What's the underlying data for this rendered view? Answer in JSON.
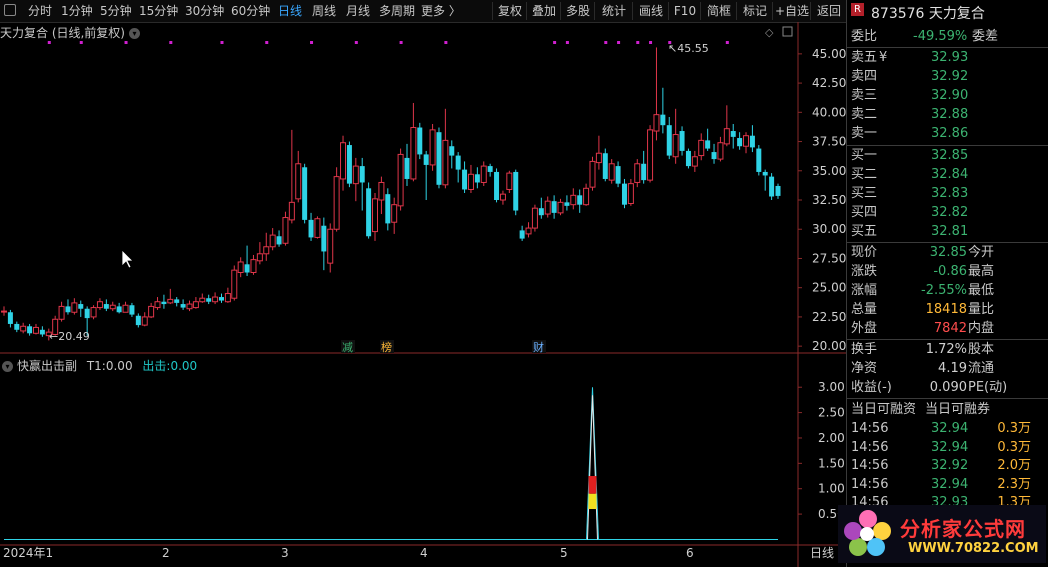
{
  "toolbar": {
    "periods": [
      "分时",
      "1分钟",
      "5分钟",
      "15分钟",
      "30分钟",
      "60分钟",
      "日线",
      "周线",
      "月线",
      "多周期",
      "更多 〉"
    ],
    "active_period": "日线",
    "right_buttons": [
      "复权",
      "叠加",
      "多股",
      "统计",
      "画线",
      "F10",
      "简框",
      "标记",
      "+自选",
      "返回"
    ]
  },
  "main_chart_title": "天力复合 (日线,前复权)",
  "sub_indicator": {
    "name": "快赢出击副",
    "t1_label": "T1:",
    "t1_value": "0.00",
    "chuji_label": "出击:",
    "chuji_value": "0.00"
  },
  "markers": [
    "减",
    "榜",
    "财"
  ],
  "date_axis": [
    "2024年1",
    "2",
    "3",
    "4",
    "5",
    "6"
  ],
  "period_label": "日线",
  "annotations": {
    "high": "45.55",
    "low": "20.49"
  },
  "quote": {
    "badge": "R",
    "code_name": "873576 天力复合",
    "weibi_label": "委比",
    "weibi_value": "-49.59%",
    "weicha_label": "委差",
    "sell": [
      {
        "label": "卖五",
        "value": "32.93"
      },
      {
        "label": "卖四",
        "value": "32.92"
      },
      {
        "label": "卖三",
        "value": "32.90"
      },
      {
        "label": "卖二",
        "value": "32.88"
      },
      {
        "label": "卖一",
        "value": "32.86"
      }
    ],
    "buy": [
      {
        "label": "买一",
        "value": "32.85"
      },
      {
        "label": "买二",
        "value": "32.84"
      },
      {
        "label": "买三",
        "value": "32.83"
      },
      {
        "label": "买四",
        "value": "32.82"
      },
      {
        "label": "买五",
        "value": "32.81"
      }
    ],
    "yen": "¥",
    "stats": [
      {
        "l": "现价",
        "v": "32.85",
        "c": "#3cb371",
        "r": "今开"
      },
      {
        "l": "涨跌",
        "v": "-0.86",
        "c": "#3cb371",
        "r": "最高"
      },
      {
        "l": "涨幅",
        "v": "-2.55%",
        "c": "#3cb371",
        "r": "最低"
      },
      {
        "l": "总量",
        "v": "18418",
        "c": "#ffb938",
        "r": "量比"
      },
      {
        "l": "外盘",
        "v": "7842",
        "c": "#ff4d4d",
        "r": "内盘"
      }
    ],
    "stats2": [
      {
        "l": "换手",
        "v": "1.72%",
        "r": "股本"
      },
      {
        "l": "净资",
        "v": "4.19",
        "r": "流通"
      },
      {
        "l": "收益(-)",
        "v": "0.090",
        "r": "PE(动)"
      }
    ],
    "margin_left": "当日可融资",
    "margin_right": "当日可融券",
    "ticks": [
      {
        "t": "14:56",
        "p": "32.94",
        "v": "0.3万"
      },
      {
        "t": "14:56",
        "p": "32.94",
        "v": "0.3万"
      },
      {
        "t": "14:56",
        "p": "32.92",
        "v": "2.0万"
      },
      {
        "t": "14:56",
        "p": "32.94",
        "v": "2.3万"
      },
      {
        "t": "14:56",
        "p": "32.93",
        "v": "1.3万"
      }
    ]
  },
  "logo": {
    "text": "分析家公式网",
    "url": "WWW.70822.COM"
  },
  "colors": {
    "up": "#e0364a",
    "down": "#2fd3e6",
    "accent": "#39a7ff",
    "magenta": "#d020d0"
  },
  "chart_data": [
    {
      "type": "candlestick",
      "title": "天力复合 (日线,前复权)",
      "yticks": [
        20.0,
        22.5,
        25.0,
        27.5,
        30.0,
        32.5,
        35.0,
        37.5,
        40.0,
        42.5,
        45.0
      ],
      "ylim": [
        19.5,
        46.1
      ],
      "annotations": [
        {
          "text": "45.55",
          "value": 45.55
        },
        {
          "text": "20.49",
          "value": 20.49
        }
      ],
      "candles": [
        {
          "o": 23.0,
          "c": 23.0,
          "h": 23.4,
          "l": 22.6
        },
        {
          "o": 22.9,
          "c": 21.9,
          "h": 23.1,
          "l": 21.6
        },
        {
          "o": 21.9,
          "c": 21.4,
          "h": 22.1,
          "l": 21.2
        },
        {
          "o": 21.3,
          "c": 21.7,
          "h": 22.0,
          "l": 21.1
        },
        {
          "o": 21.7,
          "c": 21.1,
          "h": 21.9,
          "l": 20.9
        },
        {
          "o": 21.1,
          "c": 21.6,
          "h": 21.9,
          "l": 21.0
        },
        {
          "o": 21.4,
          "c": 21.0,
          "h": 21.7,
          "l": 20.8
        },
        {
          "o": 20.9,
          "c": 21.2,
          "h": 21.5,
          "l": 20.49
        },
        {
          "o": 21.0,
          "c": 22.3,
          "h": 22.6,
          "l": 20.9
        },
        {
          "o": 22.3,
          "c": 23.4,
          "h": 23.8,
          "l": 22.1
        },
        {
          "o": 23.4,
          "c": 22.9,
          "h": 24.0,
          "l": 22.7
        },
        {
          "o": 22.9,
          "c": 23.7,
          "h": 24.1,
          "l": 22.7
        },
        {
          "o": 23.6,
          "c": 23.2,
          "h": 23.9,
          "l": 22.5
        },
        {
          "o": 23.2,
          "c": 22.4,
          "h": 23.4,
          "l": 20.9
        },
        {
          "o": 22.5,
          "c": 23.3,
          "h": 23.5,
          "l": 22.3
        },
        {
          "o": 23.3,
          "c": 23.8,
          "h": 24.1,
          "l": 23.1
        },
        {
          "o": 23.6,
          "c": 23.2,
          "h": 24.0,
          "l": 23.0
        },
        {
          "o": 23.2,
          "c": 23.5,
          "h": 23.8,
          "l": 23.0
        },
        {
          "o": 23.4,
          "c": 22.9,
          "h": 23.7,
          "l": 22.8
        },
        {
          "o": 22.9,
          "c": 23.5,
          "h": 23.8,
          "l": 22.9
        },
        {
          "o": 23.5,
          "c": 22.7,
          "h": 23.7,
          "l": 22.5
        },
        {
          "o": 22.6,
          "c": 21.8,
          "h": 22.8,
          "l": 21.6
        },
        {
          "o": 21.8,
          "c": 22.5,
          "h": 22.9,
          "l": 21.7
        },
        {
          "o": 22.5,
          "c": 23.4,
          "h": 23.7,
          "l": 22.4
        },
        {
          "o": 23.3,
          "c": 23.8,
          "h": 24.2,
          "l": 23.1
        },
        {
          "o": 23.8,
          "c": 23.6,
          "h": 24.4,
          "l": 23.2
        },
        {
          "o": 23.7,
          "c": 24.0,
          "h": 24.9,
          "l": 23.6
        },
        {
          "o": 24.0,
          "c": 23.7,
          "h": 24.2,
          "l": 23.4
        },
        {
          "o": 23.6,
          "c": 23.3,
          "h": 24.0,
          "l": 23.1
        },
        {
          "o": 23.2,
          "c": 23.6,
          "h": 23.9,
          "l": 23.0
        },
        {
          "o": 23.3,
          "c": 23.8,
          "h": 24.2,
          "l": 23.2
        },
        {
          "o": 23.8,
          "c": 24.1,
          "h": 24.5,
          "l": 23.7
        },
        {
          "o": 24.1,
          "c": 23.8,
          "h": 24.4,
          "l": 23.6
        },
        {
          "o": 23.8,
          "c": 24.2,
          "h": 24.6,
          "l": 23.6
        },
        {
          "o": 24.2,
          "c": 23.9,
          "h": 24.5,
          "l": 23.7
        },
        {
          "o": 23.8,
          "c": 24.5,
          "h": 25.0,
          "l": 23.7
        },
        {
          "o": 24.1,
          "c": 26.5,
          "h": 26.9,
          "l": 23.9
        },
        {
          "o": 26.3,
          "c": 27.2,
          "h": 27.6,
          "l": 25.9
        },
        {
          "o": 27.0,
          "c": 26.3,
          "h": 28.6,
          "l": 26.0
        },
        {
          "o": 26.3,
          "c": 27.4,
          "h": 27.8,
          "l": 26.1
        },
        {
          "o": 27.3,
          "c": 27.9,
          "h": 28.9,
          "l": 27.0
        },
        {
          "o": 27.9,
          "c": 28.5,
          "h": 29.7,
          "l": 27.3
        },
        {
          "o": 28.5,
          "c": 29.5,
          "h": 30.1,
          "l": 28.2
        },
        {
          "o": 29.4,
          "c": 28.7,
          "h": 29.9,
          "l": 28.5
        },
        {
          "o": 28.8,
          "c": 31.0,
          "h": 31.5,
          "l": 28.6
        },
        {
          "o": 30.8,
          "c": 32.3,
          "h": 38.5,
          "l": 30.5
        },
        {
          "o": 32.6,
          "c": 35.6,
          "h": 36.7,
          "l": 32.3
        },
        {
          "o": 35.3,
          "c": 30.8,
          "h": 35.6,
          "l": 30.5
        },
        {
          "o": 30.8,
          "c": 29.3,
          "h": 31.4,
          "l": 29.0
        },
        {
          "o": 29.3,
          "c": 30.9,
          "h": 31.1,
          "l": 29.2
        },
        {
          "o": 30.3,
          "c": 28.1,
          "h": 31.0,
          "l": 26.5
        },
        {
          "o": 27.1,
          "c": 30.0,
          "h": 30.5,
          "l": 26.3
        },
        {
          "o": 30.0,
          "c": 34.5,
          "h": 35.3,
          "l": 29.8
        },
        {
          "o": 34.3,
          "c": 37.4,
          "h": 38.0,
          "l": 33.3
        },
        {
          "o": 37.2,
          "c": 33.9,
          "h": 37.5,
          "l": 33.6
        },
        {
          "o": 33.9,
          "c": 35.4,
          "h": 36.1,
          "l": 32.4
        },
        {
          "o": 35.4,
          "c": 34.0,
          "h": 36.1,
          "l": 31.6
        },
        {
          "o": 33.5,
          "c": 29.4,
          "h": 34.0,
          "l": 29.2
        },
        {
          "o": 29.8,
          "c": 32.6,
          "h": 33.1,
          "l": 29.0
        },
        {
          "o": 32.5,
          "c": 34.0,
          "h": 34.5,
          "l": 31.3
        },
        {
          "o": 33.0,
          "c": 30.5,
          "h": 33.5,
          "l": 29.9
        },
        {
          "o": 30.6,
          "c": 32.1,
          "h": 32.7,
          "l": 29.6
        },
        {
          "o": 32.0,
          "c": 36.4,
          "h": 36.9,
          "l": 31.6
        },
        {
          "o": 36.1,
          "c": 34.3,
          "h": 37.3,
          "l": 33.7
        },
        {
          "o": 34.3,
          "c": 38.7,
          "h": 40.8,
          "l": 34.1
        },
        {
          "o": 38.7,
          "c": 36.4,
          "h": 39.1,
          "l": 36.0
        },
        {
          "o": 36.4,
          "c": 35.5,
          "h": 36.7,
          "l": 32.5
        },
        {
          "o": 35.5,
          "c": 38.5,
          "h": 39.0,
          "l": 35.0
        },
        {
          "o": 38.3,
          "c": 33.8,
          "h": 38.7,
          "l": 33.5
        },
        {
          "o": 33.8,
          "c": 37.6,
          "h": 40.3,
          "l": 33.5
        },
        {
          "o": 37.1,
          "c": 36.3,
          "h": 37.6,
          "l": 35.2
        },
        {
          "o": 36.3,
          "c": 35.1,
          "h": 36.6,
          "l": 34.0
        },
        {
          "o": 35.1,
          "c": 33.4,
          "h": 35.8,
          "l": 33.1
        },
        {
          "o": 33.4,
          "c": 34.7,
          "h": 35.5,
          "l": 33.1
        },
        {
          "o": 34.7,
          "c": 34.0,
          "h": 35.3,
          "l": 33.5
        },
        {
          "o": 34.0,
          "c": 35.4,
          "h": 35.8,
          "l": 33.7
        },
        {
          "o": 35.4,
          "c": 34.9,
          "h": 35.6,
          "l": 34.5
        },
        {
          "o": 34.9,
          "c": 32.5,
          "h": 35.2,
          "l": 32.3
        },
        {
          "o": 32.5,
          "c": 33.0,
          "h": 33.3,
          "l": 32.1
        },
        {
          "o": 33.4,
          "c": 34.8,
          "h": 35.0,
          "l": 33.1
        },
        {
          "o": 34.9,
          "c": 31.6,
          "h": 35.1,
          "l": 31.2
        },
        {
          "o": 29.9,
          "c": 29.2,
          "h": 30.3,
          "l": 29.0
        },
        {
          "o": 29.6,
          "c": 30.1,
          "h": 30.6,
          "l": 29.3
        },
        {
          "o": 30.1,
          "c": 31.8,
          "h": 32.1,
          "l": 29.8
        },
        {
          "o": 31.8,
          "c": 31.2,
          "h": 32.7,
          "l": 30.9
        },
        {
          "o": 31.3,
          "c": 32.4,
          "h": 32.8,
          "l": 31.0
        },
        {
          "o": 32.4,
          "c": 31.4,
          "h": 32.9,
          "l": 30.9
        },
        {
          "o": 31.4,
          "c": 32.3,
          "h": 32.6,
          "l": 31.2
        },
        {
          "o": 32.3,
          "c": 32.0,
          "h": 32.9,
          "l": 31.6
        },
        {
          "o": 32.1,
          "c": 32.9,
          "h": 33.5,
          "l": 31.7
        },
        {
          "o": 32.9,
          "c": 32.1,
          "h": 33.4,
          "l": 31.4
        },
        {
          "o": 32.1,
          "c": 33.5,
          "h": 33.9,
          "l": 32.0
        },
        {
          "o": 33.6,
          "c": 35.8,
          "h": 36.2,
          "l": 33.3
        },
        {
          "o": 35.7,
          "c": 36.5,
          "h": 38.0,
          "l": 35.1
        },
        {
          "o": 36.5,
          "c": 34.3,
          "h": 36.9,
          "l": 34.1
        },
        {
          "o": 34.2,
          "c": 35.6,
          "h": 36.0,
          "l": 33.9
        },
        {
          "o": 35.4,
          "c": 33.9,
          "h": 35.8,
          "l": 33.6
        },
        {
          "o": 33.9,
          "c": 32.1,
          "h": 34.3,
          "l": 31.8
        },
        {
          "o": 32.2,
          "c": 33.9,
          "h": 34.3,
          "l": 32.0
        },
        {
          "o": 34.0,
          "c": 35.6,
          "h": 36.0,
          "l": 33.6
        },
        {
          "o": 35.6,
          "c": 34.2,
          "h": 36.7,
          "l": 33.9
        },
        {
          "o": 34.2,
          "c": 38.5,
          "h": 38.9,
          "l": 34.0
        },
        {
          "o": 38.4,
          "c": 39.8,
          "h": 45.55,
          "l": 37.6
        },
        {
          "o": 39.8,
          "c": 38.9,
          "h": 42.1,
          "l": 38.2
        },
        {
          "o": 38.9,
          "c": 36.3,
          "h": 39.6,
          "l": 36.0
        },
        {
          "o": 36.2,
          "c": 38.1,
          "h": 40.3,
          "l": 35.6
        },
        {
          "o": 38.4,
          "c": 36.7,
          "h": 38.8,
          "l": 36.3
        },
        {
          "o": 36.7,
          "c": 35.4,
          "h": 36.9,
          "l": 35.2
        },
        {
          "o": 35.4,
          "c": 36.2,
          "h": 36.7,
          "l": 34.9
        },
        {
          "o": 36.3,
          "c": 37.6,
          "h": 38.2,
          "l": 35.9
        },
        {
          "o": 37.6,
          "c": 36.9,
          "h": 38.6,
          "l": 36.7
        },
        {
          "o": 36.6,
          "c": 36.0,
          "h": 37.3,
          "l": 35.6
        },
        {
          "o": 36.0,
          "c": 37.4,
          "h": 37.9,
          "l": 35.8
        },
        {
          "o": 37.3,
          "c": 38.6,
          "h": 40.6,
          "l": 37.1
        },
        {
          "o": 38.4,
          "c": 37.9,
          "h": 39.0,
          "l": 36.9
        },
        {
          "o": 37.8,
          "c": 37.1,
          "h": 38.3,
          "l": 36.8
        },
        {
          "o": 37.1,
          "c": 38.0,
          "h": 38.3,
          "l": 36.5
        },
        {
          "o": 38.0,
          "c": 37.0,
          "h": 38.9,
          "l": 36.6
        },
        {
          "o": 36.9,
          "c": 34.9,
          "h": 37.2,
          "l": 34.6
        },
        {
          "o": 34.9,
          "c": 34.6,
          "h": 35.1,
          "l": 33.3
        },
        {
          "o": 34.5,
          "c": 32.8,
          "h": 34.8,
          "l": 32.5
        },
        {
          "o": 33.7,
          "c": 32.85,
          "h": 33.9,
          "l": 32.6
        }
      ]
    },
    {
      "type": "line",
      "title": "快赢出击副",
      "yticks": [
        0.5,
        1.0,
        1.5,
        2.0,
        2.5,
        3.0
      ],
      "ylim": [
        -0.05,
        3.3
      ],
      "series": [
        {
          "name": "T1",
          "peak_index": 92,
          "peak_value": 3.0,
          "baseline": 0.0
        }
      ],
      "signal_bar": {
        "index": 92,
        "red": [
          0.9,
          1.25
        ],
        "yellow": [
          0.6,
          0.9
        ]
      }
    }
  ]
}
